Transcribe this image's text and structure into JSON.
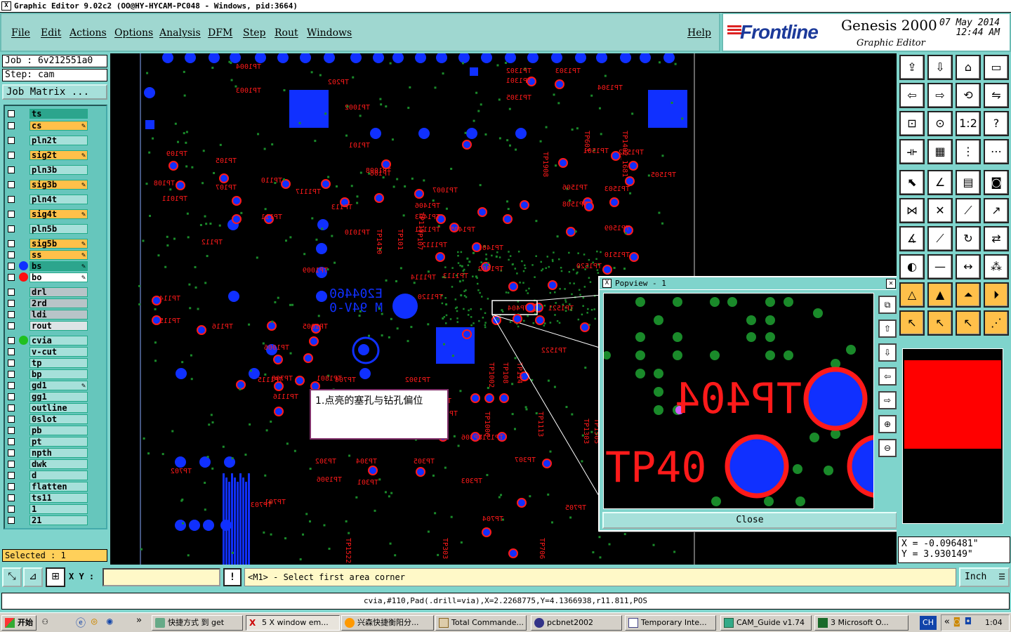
{
  "window": {
    "title": "Graphic Editor 9.02c2 (OO@HY-HYCAM-PC048 - Windows, pid:3664)"
  },
  "menu": {
    "items": [
      "File",
      "Edit",
      "Actions",
      "Options",
      "Analysis",
      "DFM",
      "Step",
      "Rout",
      "Windows"
    ],
    "help": "Help"
  },
  "brand": {
    "logo": "Frontline",
    "product": "Genesis 2000",
    "subtitle": "Graphic Editor",
    "date": "07 May 2014",
    "time": "12:44 AM"
  },
  "job": {
    "job_label": "Job : 6v212551a0",
    "step_label": "Step: cam",
    "matrix_button": "Job Matrix ..."
  },
  "layers": [
    {
      "name": "ts",
      "color": "#2ca58d",
      "tick": false,
      "dot": ""
    },
    {
      "name": "cs",
      "color": "#ffc04a",
      "tick": true,
      "dot": ""
    },
    {
      "name": "pln2t",
      "color": "#a6e0da",
      "tick": false,
      "dot": ""
    },
    {
      "name": "sig2t",
      "color": "#ffc04a",
      "tick": true,
      "dot": ""
    },
    {
      "name": "pln3b",
      "color": "#a6e0da",
      "tick": false,
      "dot": ""
    },
    {
      "name": "sig3b",
      "color": "#ffc04a",
      "tick": true,
      "dot": ""
    },
    {
      "name": "pln4t",
      "color": "#a6e0da",
      "tick": false,
      "dot": ""
    },
    {
      "name": "sig4t",
      "color": "#ffc04a",
      "tick": true,
      "dot": ""
    },
    {
      "name": "pln5b",
      "color": "#a6e0da",
      "tick": false,
      "dot": ""
    },
    {
      "name": "sig5b",
      "color": "#ffc04a",
      "tick": true,
      "dot": ""
    },
    {
      "name": "ss",
      "color": "#ffc04a",
      "tick": true,
      "dot": ""
    },
    {
      "name": "bs",
      "color": "#2ca58d",
      "tick": true,
      "dot": "#1030ff"
    },
    {
      "name": "bo",
      "color": "#ffffff",
      "tick": true,
      "dot": "#ff1010"
    },
    {
      "name": "drl",
      "color": "#b8c4c8",
      "tick": false,
      "dot": ""
    },
    {
      "name": "2rd",
      "color": "#b8c4c8",
      "tick": false,
      "dot": ""
    },
    {
      "name": "ldi",
      "color": "#b8c4c8",
      "tick": false,
      "dot": ""
    },
    {
      "name": "rout",
      "color": "#dde4e6",
      "tick": false,
      "dot": ""
    },
    {
      "name": "cvia",
      "color": "#a6e0da",
      "tick": false,
      "dot": "#20c020"
    },
    {
      "name": "v-cut",
      "color": "#a6e0da",
      "tick": false,
      "dot": ""
    },
    {
      "name": "tp",
      "color": "#a6e0da",
      "tick": false,
      "dot": ""
    },
    {
      "name": "bp",
      "color": "#a6e0da",
      "tick": false,
      "dot": ""
    },
    {
      "name": "gd1",
      "color": "#a6e0da",
      "tick": true,
      "dot": ""
    },
    {
      "name": "gg1",
      "color": "#a6e0da",
      "tick": false,
      "dot": ""
    },
    {
      "name": "outline",
      "color": "#a6e0da",
      "tick": false,
      "dot": ""
    },
    {
      "name": "0slot",
      "color": "#a6e0da",
      "tick": false,
      "dot": ""
    },
    {
      "name": "pb",
      "color": "#a6e0da",
      "tick": false,
      "dot": ""
    },
    {
      "name": "pt",
      "color": "#a6e0da",
      "tick": false,
      "dot": ""
    },
    {
      "name": "npth",
      "color": "#a6e0da",
      "tick": false,
      "dot": ""
    },
    {
      "name": "dwk",
      "color": "#a6e0da",
      "tick": false,
      "dot": ""
    },
    {
      "name": "d",
      "color": "#a6e0da",
      "tick": false,
      "dot": ""
    },
    {
      "name": "flatten",
      "color": "#a6e0da",
      "tick": false,
      "dot": ""
    },
    {
      "name": "ts11",
      "color": "#a6e0da",
      "tick": false,
      "dot": ""
    },
    {
      "name": "1",
      "color": "#a6e0da",
      "tick": false,
      "dot": ""
    },
    {
      "name": "21",
      "color": "#a6e0da",
      "tick": false,
      "dot": ""
    }
  ],
  "selected": "Selected : 1",
  "command": {
    "xy_label": "X Y :",
    "xy_value": "",
    "prompt": "<M1> - Select first area corner",
    "units": "Inch"
  },
  "status": "cvia,#110,Pad(.drill=via),X=2.2268775,Y=4.1366938,r11.811,POS",
  "coords": {
    "x": "X = -0.096481\"",
    "y": "Y = 3.930149\""
  },
  "popview": {
    "title": "Popview - 1",
    "close": "Close",
    "labels": [
      "TP404",
      "TP40"
    ]
  },
  "note": "1.点亮的塞孔与钻孔偏位",
  "canvas_labels": [
    "TP1004",
    "TP1003",
    "TP202",
    "TP1002",
    "TP101",
    "TP1008",
    "TP1007",
    "TP106",
    "TP109",
    "TP105",
    "TP108",
    "TP107",
    "TP1011",
    "TP110",
    "TP113",
    "TP111",
    "TP112",
    "TP114",
    "TP115",
    "TP116",
    "TP1117",
    "TP1010",
    "TP1009",
    "TP1005",
    "TP1006",
    "TP1115",
    "TP1116",
    "TP1114",
    "TP1120",
    "TP1112",
    "TP1111",
    "TP1113",
    "TP1402",
    "TP1401",
    "TP1403",
    "TP1405",
    "TP1406",
    "TP1302",
    "TP1303",
    "TP1301",
    "TP1304",
    "TP1305",
    "TP1501",
    "TP1502",
    "TP1503",
    "TP1505",
    "TP1506",
    "TP1508",
    "TP1509",
    "TP1510",
    "TP1520",
    "TP1521",
    "TP1522",
    "TP1518",
    "TP306",
    "TP307",
    "TP302",
    "TP304",
    "TP305",
    "TP303",
    "TP301",
    "TP701",
    "TP702",
    "TP703",
    "TP704",
    "TP705",
    "TP706",
    "TP708",
    "TP1801",
    "TP1903",
    "TP1906",
    "TP1902",
    "TP1901",
    "TP1908",
    "TP1909",
    "TP1907",
    "TP1905",
    "TP1904",
    "TP601",
    "TP602",
    "TP603",
    "TP404",
    "TP401",
    "TP402",
    "TP403",
    "TP406",
    "TP405",
    "TP1402_1681",
    "TP1403_1681",
    "TP1404_1681",
    "TP1406_1681",
    "TP1407_1681",
    "TP1408_1681",
    "TP1405_1682",
    "TP1410",
    "TP810",
    "TP812"
  ],
  "taskbar": {
    "start": "开始",
    "tasks": [
      "快捷方式 到 get",
      "5 X window em...",
      "兴森快捷衡阳分...",
      "Total Commande...",
      "pcbnet2002",
      "Temporary Inte...",
      "CAM_Guide v1.74",
      "3 Microsoft O..."
    ],
    "lang": "CH",
    "clock": "1:04"
  },
  "colors": {
    "background": "#7fd4cc",
    "canvas": "#000000",
    "pad_blue": "#1030ff",
    "label_red": "#ff1a1a",
    "via_green": "#1a8a2a"
  }
}
